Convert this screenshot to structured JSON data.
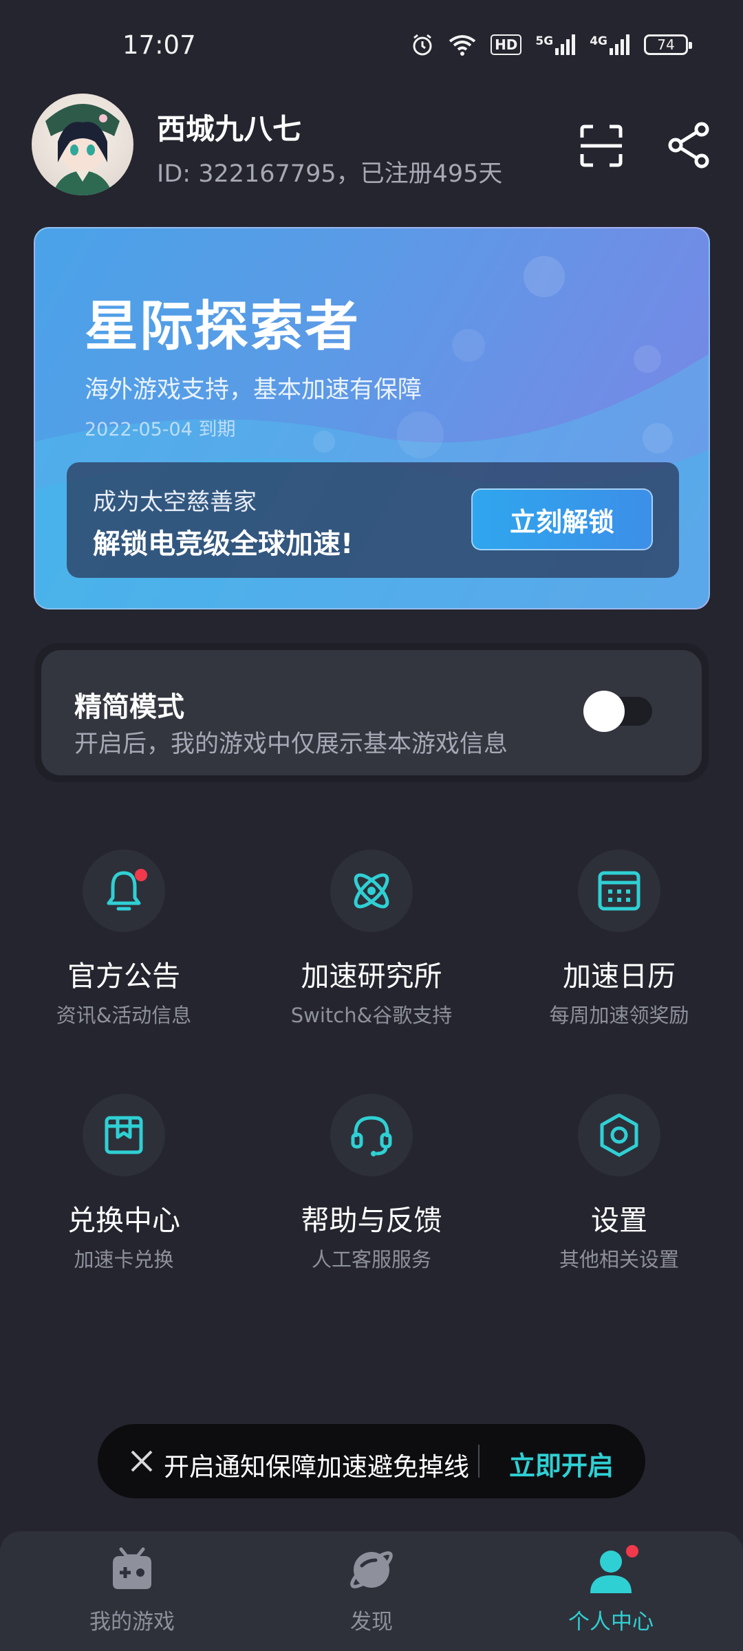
{
  "status_bar": {
    "time": "17:07",
    "battery": "74",
    "network_1": "5G",
    "network_2": "4G",
    "hd_badge": "HD"
  },
  "profile": {
    "username": "西城九八七",
    "user_id_text": "ID: 322167795，已注册495天"
  },
  "vip_card": {
    "title": "星际探索者",
    "subtitle": "海外游戏支持，基本加速有保障",
    "expire": "2022-05-04 到期",
    "promo_line1": "成为太空慈善家",
    "promo_line2": "解锁电竞级全球加速!",
    "unlock_button": "立刻解锁"
  },
  "simple_mode": {
    "title": "精简模式",
    "description": "开启后，我的游戏中仅展示基本游戏信息",
    "enabled": false
  },
  "menu": [
    {
      "label": "官方公告",
      "sub": "资讯&活动信息",
      "icon": "bell-icon",
      "badge": true
    },
    {
      "label": "加速研究所",
      "sub": "Switch&谷歌支持",
      "icon": "atom-icon",
      "badge": false
    },
    {
      "label": "加速日历",
      "sub": "每周加速领奖励",
      "icon": "calendar-icon",
      "badge": false
    },
    {
      "label": "兑换中心",
      "sub": "加速卡兑换",
      "icon": "gift-box-icon",
      "badge": false
    },
    {
      "label": "帮助与反馈",
      "sub": "人工客服服务",
      "icon": "headset-icon",
      "badge": false
    },
    {
      "label": "设置",
      "sub": "其他相关设置",
      "icon": "hexagon-settings-icon",
      "badge": false
    }
  ],
  "notification": {
    "text": "开启通知保障加速避免掉线",
    "action": "立即开启"
  },
  "bottom_nav": [
    {
      "label": "我的游戏",
      "icon": "gamepad-icon",
      "active": false
    },
    {
      "label": "发现",
      "icon": "planet-icon",
      "active": false
    },
    {
      "label": "个人中心",
      "icon": "person-icon",
      "active": true
    }
  ],
  "colors": {
    "background": "#24252e",
    "accent": "#2fd0d4",
    "badge_red": "#f2394c"
  }
}
